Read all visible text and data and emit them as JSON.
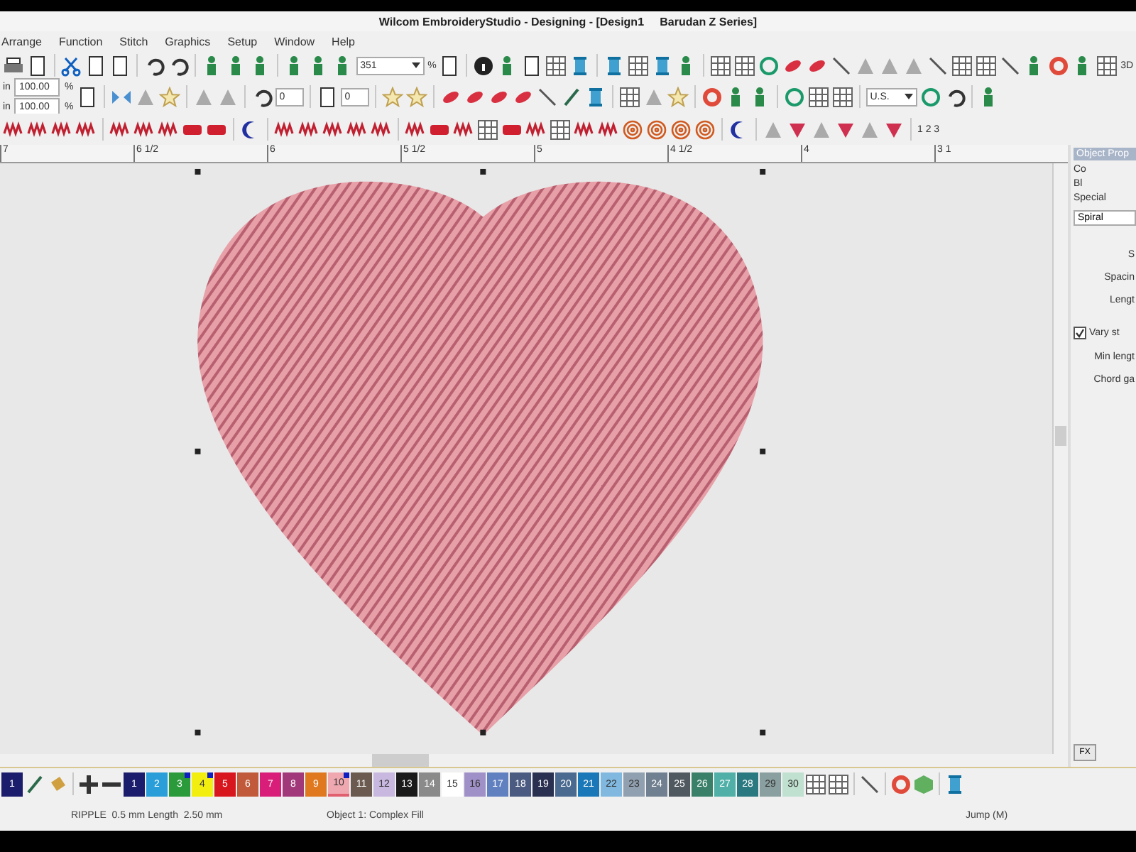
{
  "window": {
    "title": "Wilcom EmbroideryStudio - Designing - [Design1     Barudan Z Series]"
  },
  "menu": [
    "Arrange",
    "Function",
    "Stitch",
    "Graphics",
    "Setup",
    "Window",
    "Help"
  ],
  "toolbar": {
    "zoom_value": "351",
    "zoom_unit": "%",
    "scale": [
      {
        "unit": "in",
        "value": "100.00",
        "suffix": "%"
      },
      {
        "unit": "in",
        "value": "100.00",
        "suffix": "%"
      }
    ],
    "rotate_value": "0",
    "slant_value": "0",
    "units_value": "U.S.",
    "sequence_label": "1 2 3",
    "view_3d": "3D"
  },
  "ruler": {
    "labels": [
      "7",
      "6 1/2",
      "6",
      "5 1/2",
      "5",
      "4 1/2",
      "4",
      "3 1"
    ]
  },
  "properties_panel": {
    "title": "Object Prop",
    "items": [
      "Co",
      "Bl",
      "Special"
    ],
    "stitch_type": "Spiral",
    "fields": [
      "S",
      "Spacin",
      "Lengt"
    ],
    "checkbox": {
      "label": "Vary st",
      "checked": true
    },
    "fields_below": [
      "Min lengt",
      "Chord ga"
    ],
    "fx_button": "FX"
  },
  "palette": {
    "current": {
      "label": "1",
      "color": "#1c1c6c"
    },
    "swatches": [
      {
        "label": "1",
        "color": "#1c1c6c",
        "selected": false,
        "marked": false
      },
      {
        "label": "2",
        "color": "#2a9ed8",
        "selected": false,
        "marked": false
      },
      {
        "label": "3",
        "color": "#2a9a3a",
        "selected": false,
        "marked": true
      },
      {
        "label": "4",
        "color": "#f2ee10",
        "selected": false,
        "marked": true
      },
      {
        "label": "5",
        "color": "#d8161e",
        "selected": false,
        "marked": false
      },
      {
        "label": "6",
        "color": "#c05a3a",
        "selected": false,
        "marked": false
      },
      {
        "label": "7",
        "color": "#d81e78",
        "selected": false,
        "marked": false
      },
      {
        "label": "8",
        "color": "#a0387a",
        "selected": false,
        "marked": false
      },
      {
        "label": "9",
        "color": "#e07820",
        "selected": false,
        "marked": false
      },
      {
        "label": "10",
        "color": "#f0a8b0",
        "selected": true,
        "marked": true
      },
      {
        "label": "11",
        "color": "#6a5a50",
        "selected": false,
        "marked": false
      },
      {
        "label": "12",
        "color": "#c8b8e0",
        "selected": false,
        "marked": false
      },
      {
        "label": "13",
        "color": "#1a1a1a",
        "selected": false,
        "marked": false
      },
      {
        "label": "14",
        "color": "#8a8a8a",
        "selected": false,
        "marked": false
      },
      {
        "label": "15",
        "color": "#ffffff",
        "selected": false,
        "marked": false
      },
      {
        "label": "16",
        "color": "#a090c8",
        "selected": false,
        "marked": false
      },
      {
        "label": "17",
        "color": "#6080c0",
        "selected": false,
        "marked": false
      },
      {
        "label": "18",
        "color": "#4a5a80",
        "selected": false,
        "marked": false
      },
      {
        "label": "19",
        "color": "#2a3050",
        "selected": false,
        "marked": false
      },
      {
        "label": "20",
        "color": "#4a6a90",
        "selected": false,
        "marked": false
      },
      {
        "label": "21",
        "color": "#1a78b8",
        "selected": false,
        "marked": false
      },
      {
        "label": "22",
        "color": "#80b8e0",
        "selected": false,
        "marked": false
      },
      {
        "label": "23",
        "color": "#90a0b0",
        "selected": false,
        "marked": false
      },
      {
        "label": "24",
        "color": "#708090",
        "selected": false,
        "marked": false
      },
      {
        "label": "25",
        "color": "#505860",
        "selected": false,
        "marked": false
      },
      {
        "label": "26",
        "color": "#3a8068",
        "selected": false,
        "marked": false
      },
      {
        "label": "27",
        "color": "#50b0a8",
        "selected": false,
        "marked": false
      },
      {
        "label": "28",
        "color": "#2a7880",
        "selected": false,
        "marked": false
      },
      {
        "label": "29",
        "color": "#8aa0a0",
        "selected": false,
        "marked": false
      },
      {
        "label": "30",
        "color": "#c0e0d0",
        "selected": false,
        "marked": false
      }
    ]
  },
  "status_bar": {
    "stitch_info": "RIPPLE  0.5 mm Length  2.50 mm",
    "object_info": "Object 1: Complex Fill",
    "mode": "Jump (M)"
  }
}
